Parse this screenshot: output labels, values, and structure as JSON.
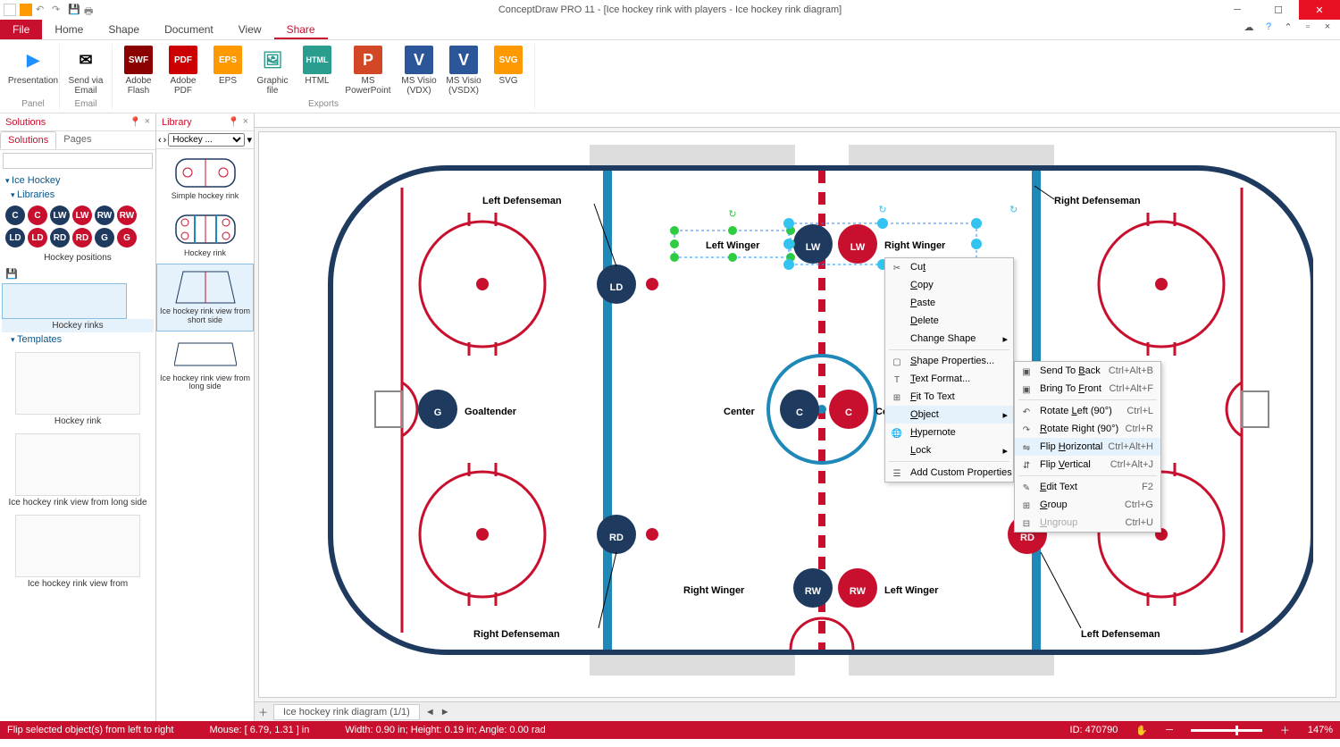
{
  "title": "ConceptDraw PRO 11 - [Ice hockey rink with players - Ice hockey rink diagram]",
  "menu": {
    "file": "File",
    "home": "Home",
    "shape": "Shape",
    "document": "Document",
    "view": "View",
    "share": "Share"
  },
  "ribbon": {
    "panel_group": "Panel",
    "email_group": "Email",
    "exports_group": "Exports",
    "presentation": "Presentation",
    "send_email": "Send via Email",
    "adobe_flash": "Adobe Flash",
    "adobe_pdf": "Adobe PDF",
    "eps": "EPS",
    "graphic_file": "Graphic file",
    "html": "HTML",
    "ms_ppt": "MS PowerPoint",
    "visio_vdx": "MS Visio (VDX)",
    "visio_vsdx": "MS Visio (VSDX)",
    "svg": "SVG"
  },
  "solutions": {
    "title": "Solutions",
    "tab_solutions": "Solutions",
    "tab_pages": "Pages",
    "root": "Ice Hockey",
    "libraries": "Libraries",
    "templates": "Templates",
    "hockey_positions": "Hockey positions",
    "hockey_rinks": "Hockey rinks",
    "tmpl1": "Hockey rink",
    "tmpl2": "Ice hockey rink view from long side",
    "tmpl3": "Ice hockey rink view from"
  },
  "library": {
    "title": "Library",
    "dropdown": "Hockey ...",
    "items": [
      "Simple hockey rink",
      "Hockey rink",
      "Ice hockey rink view from short side",
      "Ice hockey rink view from long side"
    ]
  },
  "rink": {
    "left_def": "Left Defenseman",
    "right_def": "Right Defenseman",
    "goaltender": "Goaltender",
    "center": "Center",
    "left_winger": "Left Winger",
    "right_winger": "Right Winger",
    "right_def2": "Right Defenseman",
    "left_def2": "Left Defenseman",
    "G": "G",
    "LD": "LD",
    "RD": "RD",
    "C": "C",
    "LW": "LW",
    "RW": "RW"
  },
  "ctx1": [
    {
      "l": "Cut",
      "u": "t",
      "ic": "✂"
    },
    {
      "l": "Copy",
      "u": "C"
    },
    {
      "l": "Paste",
      "u": "P"
    },
    {
      "l": "Delete",
      "u": "D"
    },
    {
      "l": "Change Shape",
      "sub": true
    },
    {
      "sep": true
    },
    {
      "l": "Shape Properties...",
      "u": "S",
      "ic": "▢"
    },
    {
      "l": "Text Format...",
      "u": "T",
      "ic": "T"
    },
    {
      "l": "Fit To Text",
      "u": "F",
      "ic": "⊞"
    },
    {
      "l": "Object",
      "u": "O",
      "sub": true,
      "hov": true
    },
    {
      "l": "Hypernote",
      "u": "H",
      "ic": "🌐"
    },
    {
      "l": "Lock",
      "u": "L",
      "sub": true
    },
    {
      "sep": true
    },
    {
      "l": "Add Custom Properties",
      "ic": "☰"
    }
  ],
  "ctx2": [
    {
      "l": "Send To Back",
      "u": "B",
      "sc": "Ctrl+Alt+B",
      "ic": "▣"
    },
    {
      "l": "Bring To Front",
      "u": "F",
      "sc": "Ctrl+Alt+F",
      "ic": "▣"
    },
    {
      "sep": true
    },
    {
      "l": "Rotate Left (90°)",
      "u": "L",
      "sc": "Ctrl+L",
      "ic": "↶"
    },
    {
      "l": "Rotate Right (90°)",
      "u": "R",
      "sc": "Ctrl+R",
      "ic": "↷"
    },
    {
      "l": "Flip Horizontal",
      "u": "H",
      "sc": "Ctrl+Alt+H",
      "ic": "⇋",
      "hov": true
    },
    {
      "l": "Flip Vertical",
      "u": "V",
      "sc": "Ctrl+Alt+J",
      "ic": "⇵"
    },
    {
      "sep": true
    },
    {
      "l": "Edit Text",
      "u": "E",
      "sc": "F2",
      "ic": "✎"
    },
    {
      "l": "Group",
      "u": "G",
      "sc": "Ctrl+G",
      "ic": "⊞"
    },
    {
      "l": "Ungroup",
      "u": "U",
      "sc": "Ctrl+U",
      "ic": "⊟",
      "dis": true
    }
  ],
  "tabbar": {
    "page": "Ice hockey rink diagram (1/1)"
  },
  "status": {
    "hint": "Flip selected object(s) from left to right",
    "mouse": "Mouse: [ 6.79, 1.31 ] in",
    "dims": "Width: 0.90 in;  Height: 0.19 in;  Angle: 0.00 rad",
    "id": "ID: 470790",
    "zoom": "147%"
  }
}
